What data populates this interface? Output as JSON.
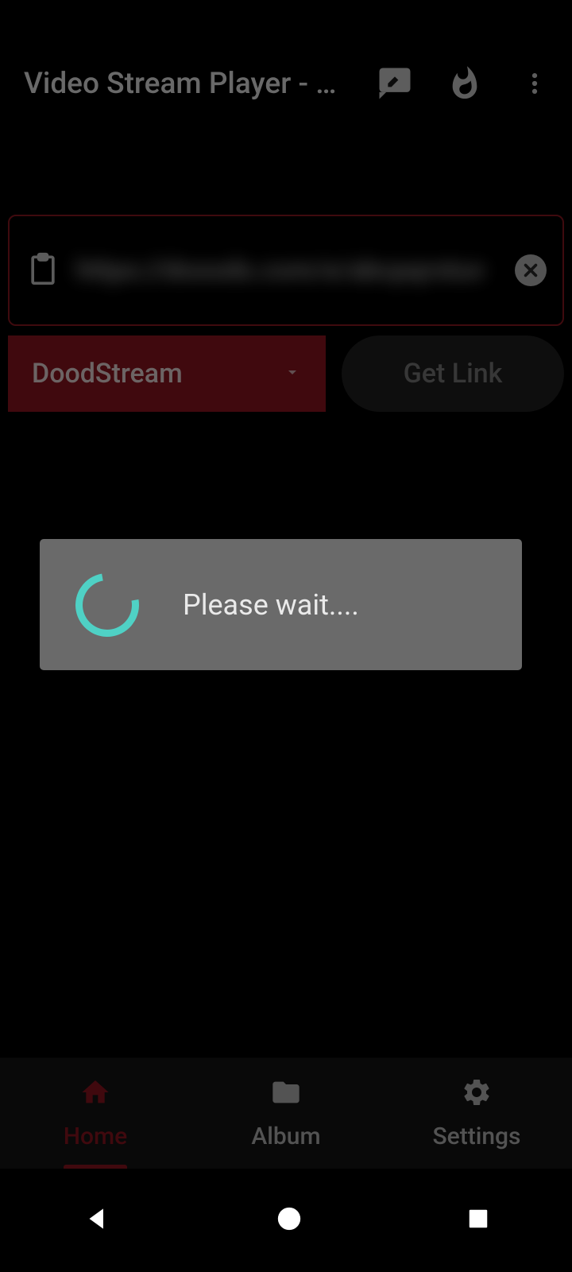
{
  "app": {
    "title": "Video Stream Player - D…"
  },
  "input": {
    "url_blurred": "https://dooods.com/e/abcpqrstuv"
  },
  "controls": {
    "provider": "DoodStream",
    "get_link_label": "Get Link"
  },
  "dialog": {
    "message": "Please wait...."
  },
  "nav": {
    "home": "Home",
    "album": "Album",
    "settings": "Settings"
  }
}
